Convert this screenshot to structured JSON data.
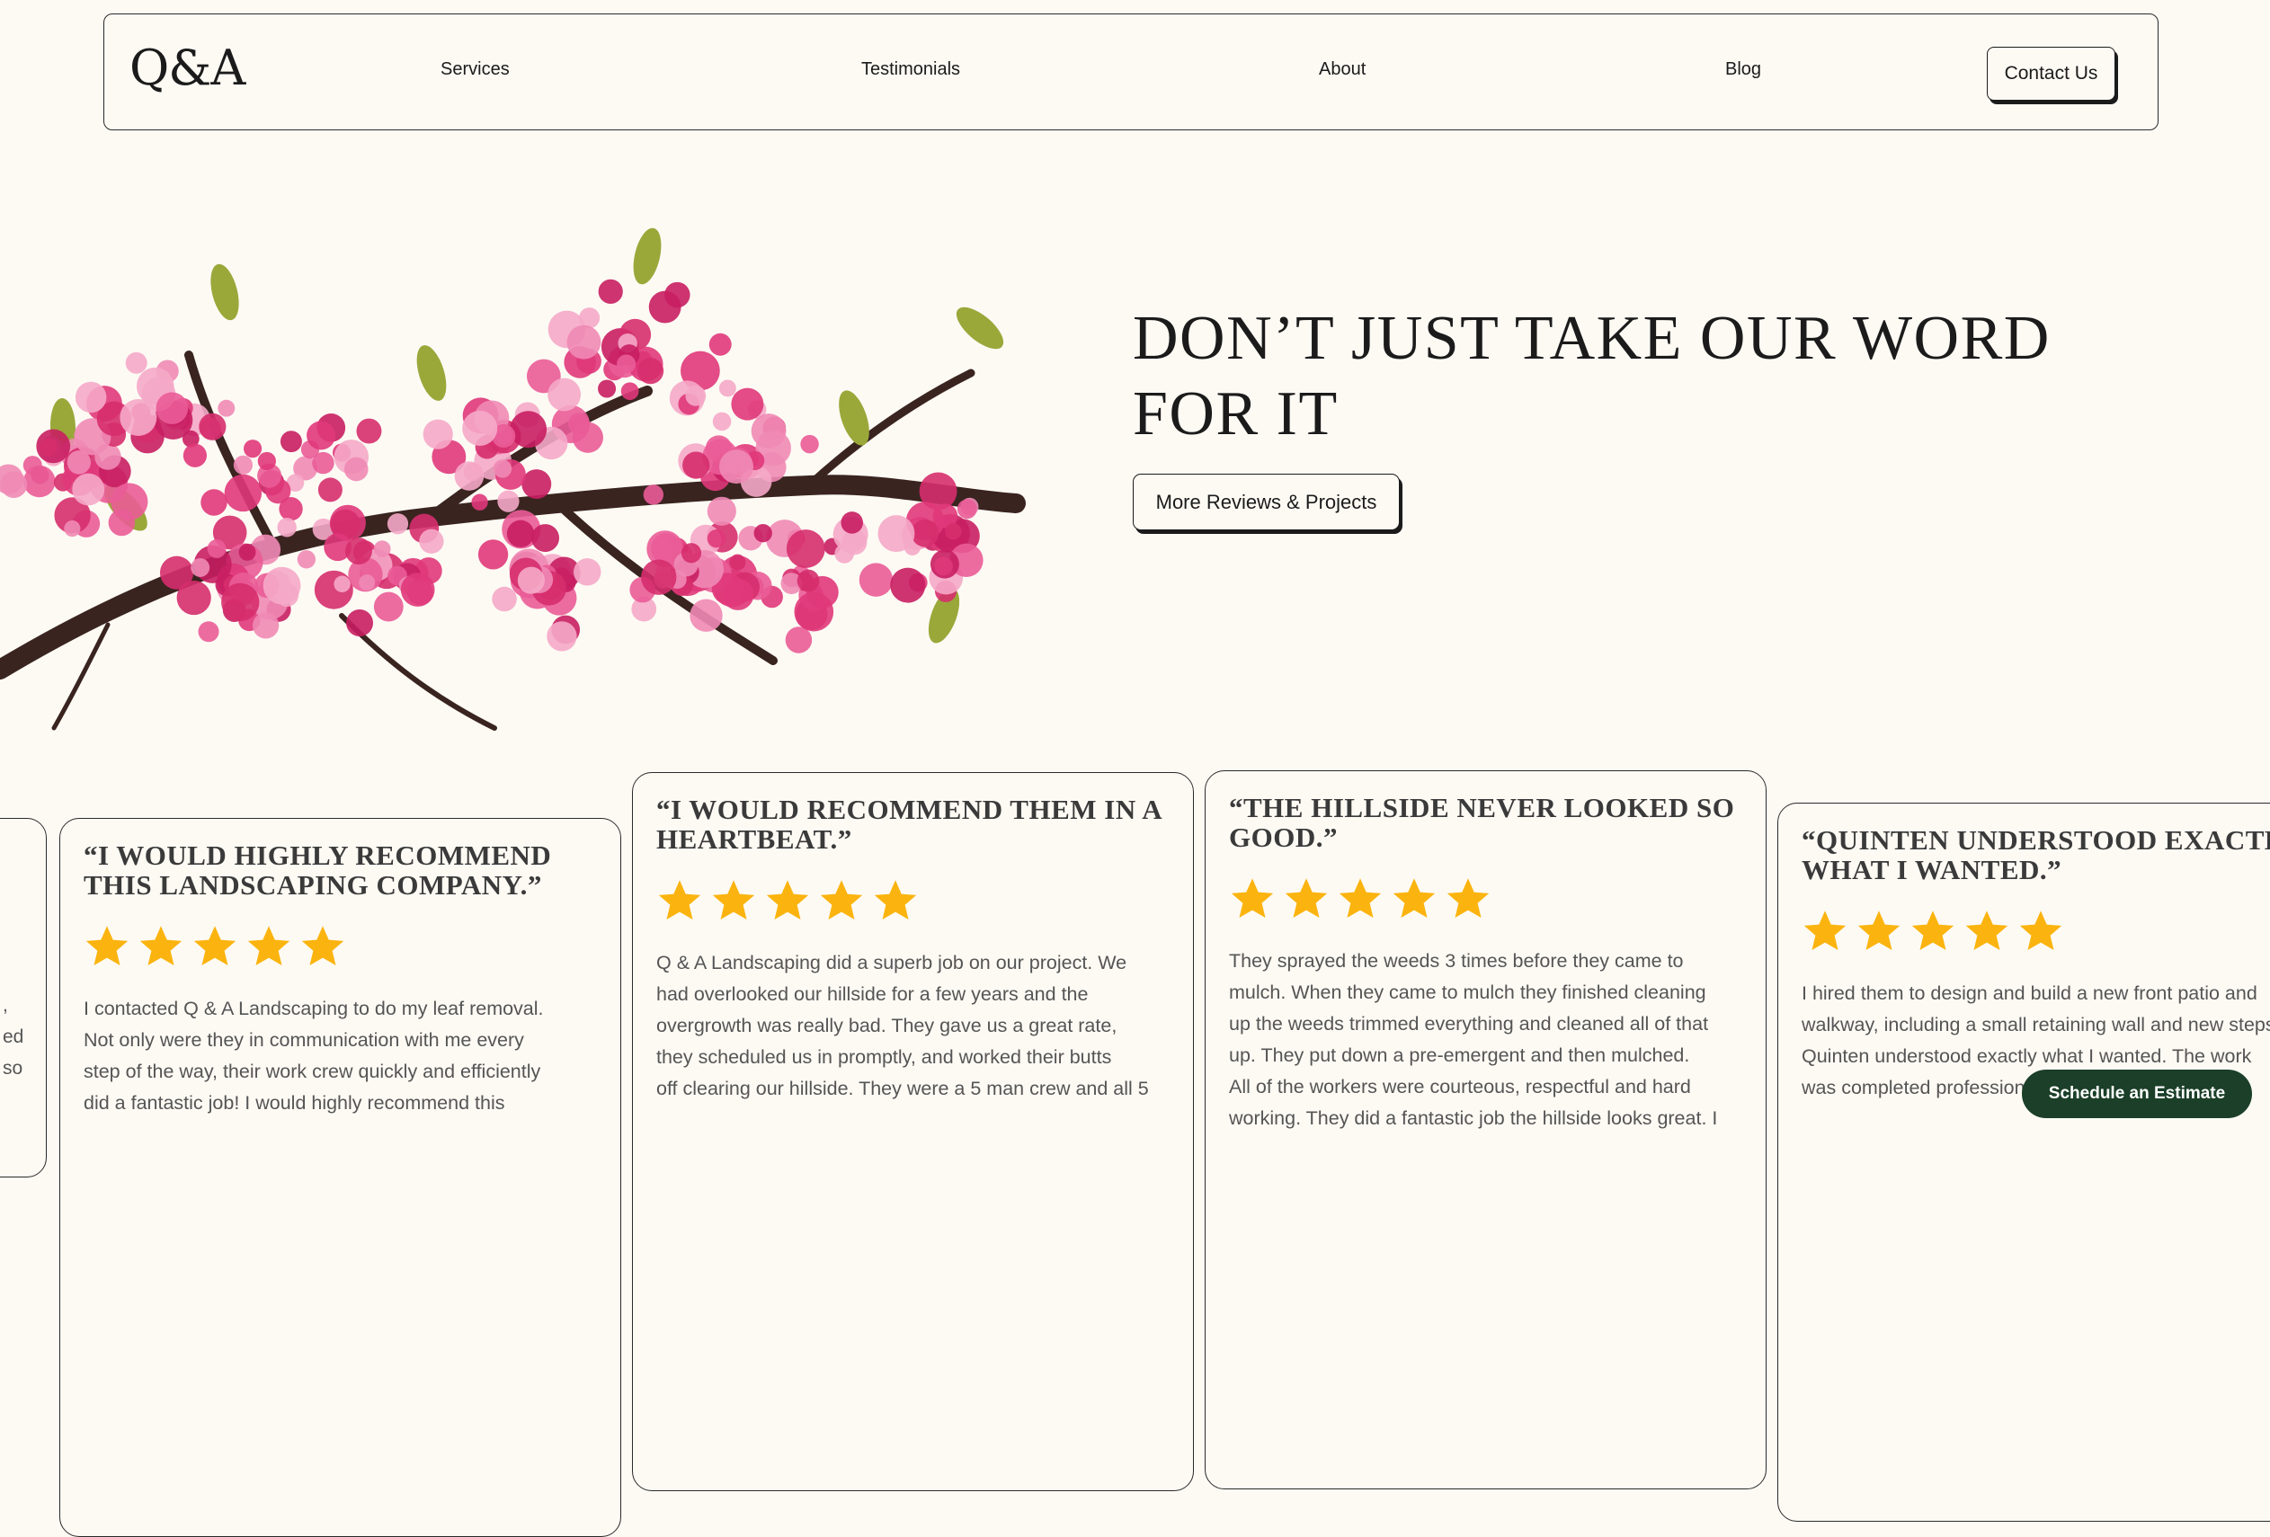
{
  "nav": {
    "logo": "Q&A",
    "links": [
      "Services",
      "Testimonials",
      "About",
      "Blog"
    ],
    "contact_label": "Contact Us"
  },
  "hero": {
    "headline": "DON’T JUST TAKE OUR WORD FOR IT",
    "button_label": "More Reviews & Projects"
  },
  "colors": {
    "background": "#fdfaf4",
    "star": "#fbb40f",
    "cta": "#1b3f28",
    "blossom": "#e0387a"
  },
  "partial_card": {
    "lines": [
      ",",
      "ed",
      "",
      "so"
    ]
  },
  "reviews": [
    {
      "title": "“I WOULD HIGHLY RECOMMEND THIS LANDSCAPING COMPANY.”",
      "rating": 5,
      "body": "I contacted Q & A Landscaping to do my leaf removal.\nNot only were they in communication with me every\nstep of the way, their work crew quickly and efficiently\ndid a fantastic job!   I would highly recommend this"
    },
    {
      "title": "“I WOULD RECOMMEND THEM IN A HEARTBEAT.”",
      "rating": 5,
      "body": "Q & A Landscaping did a superb job on our project. We\nhad overlooked our hillside for a few years and the\novergrowth was really bad. They gave us a great rate,\nthey scheduled us in promptly, and worked their butts\noff clearing our hillside. They were a 5 man crew and all 5"
    },
    {
      "title": "“THE HILLSIDE NEVER LOOKED SO GOOD.”",
      "rating": 5,
      "body": "They sprayed the weeds 3 times before they came to\nmulch. When they came to mulch they finished cleaning\nup the weeds trimmed everything and cleaned all of that\nup. They put down a pre-emergent and then mulched.\nAll of the workers were courteous, respectful and hard\nworking. They did a fantastic job the hillside looks great. I"
    },
    {
      "title": "“QUINTEN UNDERSTOOD EXACTLY WHAT I WANTED.”",
      "rating": 5,
      "body": "I hired them to design and build a new front patio and\nwalkway, including a small retaining wall and new steps.\nQuinten understood exactly what I wanted. The work\nwas completed professionally and on schedule."
    }
  ],
  "cta": {
    "label": "Schedule an Estimate"
  }
}
